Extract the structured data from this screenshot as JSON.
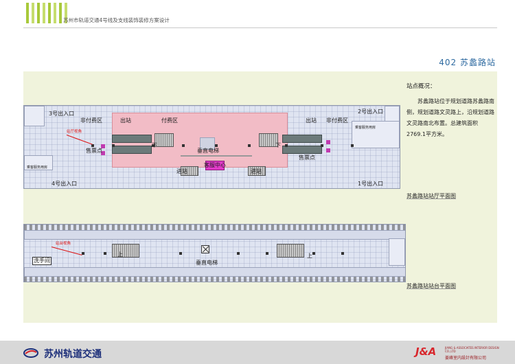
{
  "header": {
    "title": "苏州市轨道交通4号线及支线装饰装修方案设计"
  },
  "station": {
    "title": "402 苏蠡路站"
  },
  "overview": {
    "heading": "站点概况：",
    "body": "苏蠡路站位于规划道路苏蠡路南侧，规划道路文灵路上，沿规划道路文灵路南北布置。总建筑面积2769.1平方米。"
  },
  "hall_plan": {
    "caption": "苏蠡路站站厅平面图",
    "labels": {
      "exit3": "3号出入口",
      "exit2": "2号出入口",
      "exit4": "4号出入口",
      "exit1": "1号出入口",
      "nonpaid_left": "非付费区",
      "nonpaid_right": "非付费区",
      "paid": "付费区",
      "out_left": "出站",
      "out_right": "出站",
      "in_left": "进站",
      "in_right": "进站",
      "elevator": "垂直电梯",
      "ticket_left": "售票点",
      "ticket_right": "售票点",
      "info_center": "客服中心",
      "hall_view": "站厅视角",
      "service_left": "乘客服务用房",
      "service_right": "乘客服务用房",
      "down_left": "下",
      "down_right": "下"
    }
  },
  "platform_plan": {
    "caption": "苏蠡路站站台平面图",
    "labels": {
      "platform_view": "站台视角",
      "washroom": "洗手间",
      "elevator": "垂直电梯",
      "up_left": "上",
      "up_right": "上"
    }
  },
  "footer": {
    "client_name": "苏州轨道交通",
    "designer_mark": "J&A",
    "designer_en": "JIANG & ASSOCIATES INTERIOR DESIGN CO.,LTD",
    "designer_cn": "姜峰室内設計有限公司"
  },
  "colors": {
    "accent_green": "#a8c93a",
    "panel_bg": "#f0f3dc",
    "title_blue": "#2e6aa0",
    "paid_zone": "#f2bcc6",
    "info_center": "#e23ac9",
    "brand_red": "#d8272d",
    "client_blue": "#1d2f7a"
  }
}
